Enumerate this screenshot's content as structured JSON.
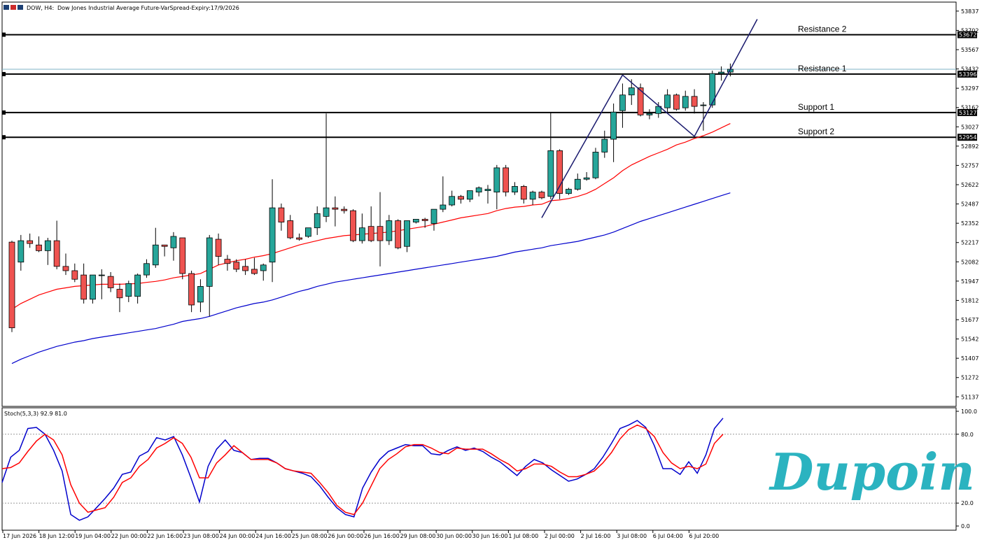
{
  "header": {
    "symbol": "DOW, H4:",
    "description": "Dow Jones Industrial Average Future-VarSpread-Expiry:17/9/2026"
  },
  "logo": {
    "text": "Dupoin"
  },
  "colors": {
    "bull": "#26a69a",
    "bear": "#ef5350",
    "ma_fast": "#ff0000",
    "ma_slow": "#0000cc",
    "stoch_k": "#0000cc",
    "stoch_d": "#ff0000",
    "level": "#000000",
    "pattern": "#1a1a6e",
    "bid": "#7fb3c4",
    "logo": "#2bb3c0"
  },
  "chart_data": [
    {
      "type": "candlestick",
      "ylim": [
        51070,
        53900
      ],
      "y_ticks": [
        "53837",
        "53702",
        "53567",
        "53432",
        "53297",
        "53162",
        "53027",
        "52892",
        "52757",
        "52622",
        "52487",
        "52352",
        "52217",
        "52082",
        "51947",
        "51812",
        "51677",
        "51542",
        "51407",
        "51272",
        "51137"
      ],
      "x_ticks": [
        "17 Jun 2026",
        "18 Jun 12:00",
        "19 Jun 04:00",
        "22 Jun 00:00",
        "22 Jun 16:00",
        "23 Jun 08:00",
        "24 Jun 00:00",
        "24 Jun 16:00",
        "25 Jun 08:00",
        "26 Jun 00:00",
        "26 Jun 16:00",
        "29 Jun 08:00",
        "30 Jun 00:00",
        "30 Jun 16:00",
        "1 Jul 08:00",
        "2 Jul 00:00",
        "2 Jul 16:00",
        "3 Jul 08:00",
        "6 Jul 04:00",
        "6 Jul 20:00"
      ],
      "ohlc": [
        [
          52220,
          52230,
          51590,
          51620
        ],
        [
          52080,
          52270,
          52020,
          52230
        ],
        [
          52230,
          52280,
          52180,
          52210
        ],
        [
          52200,
          52260,
          52150,
          52160
        ],
        [
          52160,
          52250,
          52060,
          52230
        ],
        [
          52230,
          52370,
          52030,
          52050
        ],
        [
          52050,
          52140,
          51990,
          52020
        ],
        [
          52020,
          52070,
          51940,
          51960
        ],
        [
          51990,
          52070,
          51790,
          51820
        ],
        [
          51820,
          51990,
          51790,
          51990
        ],
        [
          51990,
          52030,
          51820,
          51990
        ],
        [
          51980,
          52010,
          51870,
          51900
        ],
        [
          51890,
          51930,
          51730,
          51830
        ],
        [
          51840,
          51950,
          51800,
          51930
        ],
        [
          51840,
          52000,
          51790,
          51990
        ],
        [
          51990,
          52100,
          51970,
          52070
        ],
        [
          52060,
          52320,
          52040,
          52200
        ],
        [
          52200,
          52200,
          52120,
          52190
        ],
        [
          52180,
          52290,
          52090,
          52260
        ],
        [
          52250,
          52250,
          51960,
          52000
        ],
        [
          52000,
          52020,
          51730,
          51780
        ],
        [
          51800,
          51960,
          51730,
          51910
        ],
        [
          51910,
          52270,
          51700,
          52250
        ],
        [
          52240,
          52280,
          52060,
          52120
        ],
        [
          52100,
          52130,
          52020,
          52070
        ],
        [
          52080,
          52100,
          52010,
          52030
        ],
        [
          52050,
          52100,
          51990,
          52020
        ],
        [
          52030,
          52110,
          51990,
          52000
        ],
        [
          52020,
          52070,
          51950,
          52060
        ],
        [
          52080,
          52660,
          51940,
          52460
        ],
        [
          52460,
          52490,
          52300,
          52360
        ],
        [
          52370,
          52410,
          52240,
          52250
        ],
        [
          52250,
          52280,
          52230,
          52240
        ],
        [
          52260,
          52310,
          52250,
          52320
        ],
        [
          52320,
          52470,
          52270,
          52420
        ],
        [
          52400,
          53120,
          52360,
          52460
        ],
        [
          52460,
          52540,
          52330,
          52450
        ],
        [
          52450,
          52470,
          52420,
          52440
        ],
        [
          52440,
          52450,
          52220,
          52230
        ],
        [
          52230,
          52420,
          52210,
          52320
        ],
        [
          52330,
          52470,
          52220,
          52230
        ],
        [
          52330,
          52570,
          52050,
          52230
        ],
        [
          52230,
          52410,
          52200,
          52370
        ],
        [
          52370,
          52380,
          52170,
          52180
        ],
        [
          52190,
          52360,
          52150,
          52370
        ],
        [
          52360,
          52380,
          52350,
          52380
        ],
        [
          52380,
          52390,
          52320,
          52370
        ],
        [
          52350,
          52450,
          52300,
          52450
        ],
        [
          52450,
          52680,
          52430,
          52480
        ],
        [
          52480,
          52580,
          52470,
          52540
        ],
        [
          52540,
          52550,
          52490,
          52520
        ],
        [
          52520,
          52580,
          52500,
          52580
        ],
        [
          52570,
          52610,
          52540,
          52600
        ],
        [
          52580,
          52620,
          52490,
          52590
        ],
        [
          52570,
          52760,
          52450,
          52740
        ],
        [
          52740,
          52760,
          52540,
          52570
        ],
        [
          52570,
          52640,
          52550,
          52610
        ],
        [
          52610,
          52620,
          52490,
          52520
        ],
        [
          52520,
          52580,
          52480,
          52570
        ],
        [
          52570,
          52580,
          52520,
          52530
        ],
        [
          52540,
          53130,
          52520,
          52860
        ],
        [
          52860,
          52870,
          52520,
          52560
        ],
        [
          52560,
          52600,
          52550,
          52590
        ],
        [
          52590,
          52700,
          52580,
          52660
        ],
        [
          52660,
          52710,
          52650,
          52670
        ],
        [
          52670,
          52880,
          52660,
          52850
        ],
        [
          52850,
          53000,
          52810,
          52940
        ],
        [
          52940,
          53190,
          52780,
          53130
        ],
        [
          53140,
          53330,
          53020,
          53250
        ],
        [
          53250,
          53360,
          53180,
          53300
        ],
        [
          53300,
          53330,
          53100,
          53110
        ],
        [
          53110,
          53150,
          53080,
          53120
        ],
        [
          53120,
          53200,
          53090,
          53170
        ],
        [
          53160,
          53290,
          53130,
          53250
        ],
        [
          53250,
          53260,
          53140,
          53150
        ],
        [
          53160,
          53280,
          53140,
          53240
        ],
        [
          53240,
          53290,
          53120,
          53170
        ],
        [
          53180,
          53200,
          53000,
          53180
        ],
        [
          53180,
          53420,
          53160,
          53400
        ],
        [
          53400,
          53450,
          53350,
          53410
        ],
        [
          53410,
          53470,
          53380,
          53430
        ]
      ],
      "ma_fast": [
        51750,
        51790,
        51820,
        51850,
        51870,
        51890,
        51900,
        51910,
        51915,
        51920,
        51925,
        51925,
        51925,
        51928,
        51930,
        51938,
        51945,
        51955,
        51970,
        51980,
        51990,
        52000,
        52030,
        52060,
        52075,
        52090,
        52100,
        52115,
        52125,
        52140,
        52160,
        52180,
        52200,
        52215,
        52230,
        52245,
        52255,
        52265,
        52270,
        52275,
        52280,
        52285,
        52290,
        52300,
        52310,
        52320,
        52330,
        52345,
        52360,
        52375,
        52390,
        52400,
        52410,
        52420,
        52440,
        52455,
        52465,
        52470,
        52480,
        52485,
        52510,
        52515,
        52525,
        52540,
        52560,
        52590,
        52630,
        52670,
        52720,
        52760,
        52790,
        52820,
        52845,
        52870,
        52900,
        52920,
        52945,
        52965,
        52990,
        53020,
        53050
      ],
      "ma_slow": [
        51370,
        51400,
        51425,
        51450,
        51470,
        51490,
        51505,
        51520,
        51530,
        51545,
        51555,
        51565,
        51575,
        51585,
        51595,
        51605,
        51615,
        51630,
        51645,
        51665,
        51675,
        51685,
        51700,
        51720,
        51740,
        51760,
        51775,
        51790,
        51800,
        51815,
        51835,
        51855,
        51875,
        51890,
        51910,
        51925,
        51940,
        51950,
        51960,
        51970,
        51980,
        51990,
        52000,
        52010,
        52020,
        52030,
        52040,
        52050,
        52060,
        52070,
        52080,
        52090,
        52100,
        52110,
        52120,
        52135,
        52150,
        52160,
        52170,
        52180,
        52195,
        52205,
        52215,
        52225,
        52240,
        52255,
        52270,
        52290,
        52315,
        52340,
        52365,
        52385,
        52405,
        52425,
        52445,
        52465,
        52485,
        52505,
        52525,
        52545,
        52565
      ],
      "levels": [
        {
          "label": "Resistance 2",
          "value": 53672,
          "tag": "53672"
        },
        {
          "label": "Resistance 1",
          "value": 53396,
          "tag": "53396"
        },
        {
          "label": "Support 1",
          "value": 53127,
          "tag": "53127"
        },
        {
          "label": "Support 2",
          "value": 52954,
          "tag": "52954"
        }
      ],
      "pattern_lines": [
        [
          [
            59,
            52390
          ],
          [
            68,
            53390
          ]
        ],
        [
          [
            68,
            53390
          ],
          [
            76,
            52960
          ]
        ],
        [
          [
            76,
            52960
          ],
          [
            83,
            53780
          ]
        ]
      ]
    },
    {
      "type": "line",
      "title": "Stoch(5,3,3) 92.9 81.0",
      "ylim": [
        0,
        100
      ],
      "y_ticks": [
        "100.0",
        "80.0",
        "20.0",
        "0.0"
      ],
      "levels": [
        80,
        20
      ],
      "series": [
        {
          "key": "k",
          "values": [
            38,
            60,
            66,
            85,
            86,
            80,
            66,
            48,
            10,
            5,
            8,
            16,
            24,
            33,
            45,
            47,
            61,
            65,
            77,
            75,
            78,
            62,
            42,
            21,
            52,
            67,
            75,
            66,
            64,
            58,
            59,
            59,
            55,
            50,
            48,
            46,
            43,
            35,
            25,
            16,
            10,
            8,
            33,
            47,
            58,
            65,
            68,
            71,
            70,
            70,
            63,
            62,
            66,
            69,
            66,
            68,
            65,
            60,
            56,
            50,
            44,
            52,
            58,
            55,
            49,
            44,
            39,
            41,
            45,
            50,
            60,
            72,
            85,
            88,
            92,
            86,
            70,
            50,
            50,
            45,
            56,
            46,
            62,
            85,
            94
          ]
        },
        {
          "key": "d",
          "values": [
            50,
            51,
            55,
            65,
            74,
            80,
            75,
            62,
            36,
            20,
            12,
            14,
            16,
            25,
            38,
            42,
            52,
            58,
            68,
            72,
            77,
            72,
            60,
            42,
            42,
            55,
            62,
            70,
            64,
            58,
            58,
            58,
            55,
            50,
            48,
            47,
            46,
            38,
            29,
            18,
            12,
            10,
            20,
            35,
            50,
            58,
            63,
            69,
            71,
            71,
            68,
            64,
            63,
            68,
            67,
            67,
            67,
            63,
            58,
            54,
            48,
            50,
            54,
            54,
            52,
            47,
            43,
            43,
            45,
            48,
            55,
            64,
            76,
            84,
            88,
            85,
            78,
            64,
            55,
            50,
            52,
            50,
            54,
            72,
            80
          ]
        }
      ]
    }
  ]
}
